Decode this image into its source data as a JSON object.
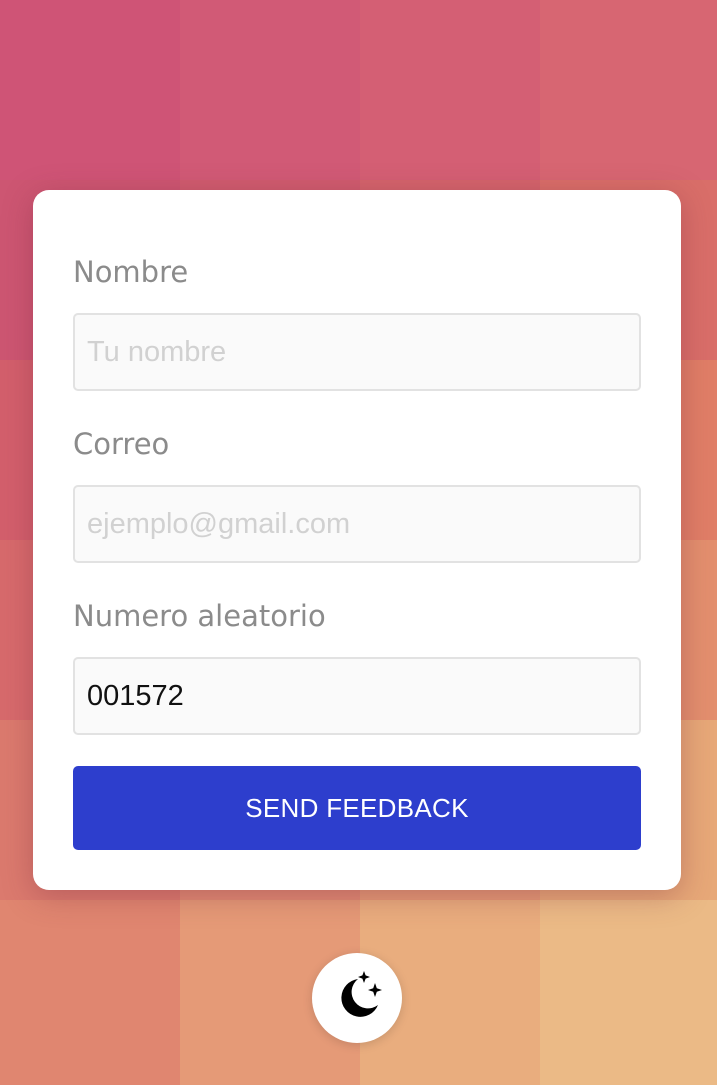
{
  "background": {
    "tiles": [
      "#cf5476",
      "#d15a76",
      "#d45f74",
      "#d76672",
      "#cd5672",
      "#d05c6f",
      "#d4646c",
      "#d96e69",
      "#d35f6c",
      "#d7676c",
      "#dc7169",
      "#e07e67",
      "#d76a6c",
      "#db766e",
      "#df8170",
      "#e38f6e",
      "#db7a6e",
      "#e08a73",
      "#e49a76",
      "#e7a878",
      "#e08670",
      "#e59a77",
      "#e9ad7e",
      "#ebba86"
    ]
  },
  "form": {
    "name_label": "Nombre",
    "name_placeholder": "Tu nombre",
    "name_value": "",
    "email_label": "Correo",
    "email_placeholder": "ejemplo@gmail.com",
    "email_value": "",
    "random_label": "Numero aleatorio",
    "random_value": "001572",
    "submit_label": "SEND FEEDBACK"
  },
  "colors": {
    "accent": "#2d3ecd",
    "card": "#ffffff",
    "label": "#8b8b8b"
  },
  "theme_toggle": {
    "icon": "moon-stars-icon"
  }
}
